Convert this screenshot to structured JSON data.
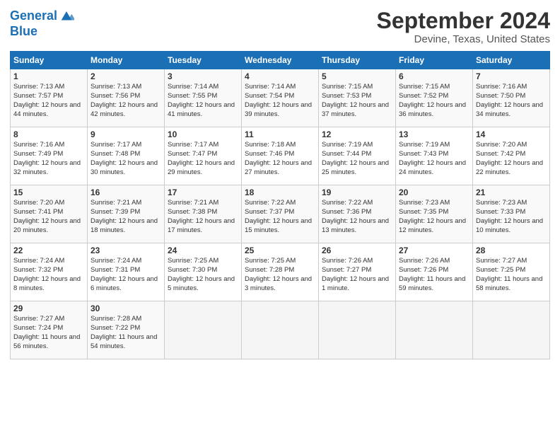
{
  "header": {
    "logo_line1": "General",
    "logo_line2": "Blue",
    "month_title": "September 2024",
    "location": "Devine, Texas, United States"
  },
  "days_of_week": [
    "Sunday",
    "Monday",
    "Tuesday",
    "Wednesday",
    "Thursday",
    "Friday",
    "Saturday"
  ],
  "weeks": [
    [
      {
        "day": "1",
        "sunrise": "7:13 AM",
        "sunset": "7:57 PM",
        "daylight": "12 hours and 44 minutes."
      },
      {
        "day": "2",
        "sunrise": "7:13 AM",
        "sunset": "7:56 PM",
        "daylight": "12 hours and 42 minutes."
      },
      {
        "day": "3",
        "sunrise": "7:14 AM",
        "sunset": "7:55 PM",
        "daylight": "12 hours and 41 minutes."
      },
      {
        "day": "4",
        "sunrise": "7:14 AM",
        "sunset": "7:54 PM",
        "daylight": "12 hours and 39 minutes."
      },
      {
        "day": "5",
        "sunrise": "7:15 AM",
        "sunset": "7:53 PM",
        "daylight": "12 hours and 37 minutes."
      },
      {
        "day": "6",
        "sunrise": "7:15 AM",
        "sunset": "7:52 PM",
        "daylight": "12 hours and 36 minutes."
      },
      {
        "day": "7",
        "sunrise": "7:16 AM",
        "sunset": "7:50 PM",
        "daylight": "12 hours and 34 minutes."
      }
    ],
    [
      {
        "day": "8",
        "sunrise": "7:16 AM",
        "sunset": "7:49 PM",
        "daylight": "12 hours and 32 minutes."
      },
      {
        "day": "9",
        "sunrise": "7:17 AM",
        "sunset": "7:48 PM",
        "daylight": "12 hours and 30 minutes."
      },
      {
        "day": "10",
        "sunrise": "7:17 AM",
        "sunset": "7:47 PM",
        "daylight": "12 hours and 29 minutes."
      },
      {
        "day": "11",
        "sunrise": "7:18 AM",
        "sunset": "7:46 PM",
        "daylight": "12 hours and 27 minutes."
      },
      {
        "day": "12",
        "sunrise": "7:19 AM",
        "sunset": "7:44 PM",
        "daylight": "12 hours and 25 minutes."
      },
      {
        "day": "13",
        "sunrise": "7:19 AM",
        "sunset": "7:43 PM",
        "daylight": "12 hours and 24 minutes."
      },
      {
        "day": "14",
        "sunrise": "7:20 AM",
        "sunset": "7:42 PM",
        "daylight": "12 hours and 22 minutes."
      }
    ],
    [
      {
        "day": "15",
        "sunrise": "7:20 AM",
        "sunset": "7:41 PM",
        "daylight": "12 hours and 20 minutes."
      },
      {
        "day": "16",
        "sunrise": "7:21 AM",
        "sunset": "7:39 PM",
        "daylight": "12 hours and 18 minutes."
      },
      {
        "day": "17",
        "sunrise": "7:21 AM",
        "sunset": "7:38 PM",
        "daylight": "12 hours and 17 minutes."
      },
      {
        "day": "18",
        "sunrise": "7:22 AM",
        "sunset": "7:37 PM",
        "daylight": "12 hours and 15 minutes."
      },
      {
        "day": "19",
        "sunrise": "7:22 AM",
        "sunset": "7:36 PM",
        "daylight": "12 hours and 13 minutes."
      },
      {
        "day": "20",
        "sunrise": "7:23 AM",
        "sunset": "7:35 PM",
        "daylight": "12 hours and 12 minutes."
      },
      {
        "day": "21",
        "sunrise": "7:23 AM",
        "sunset": "7:33 PM",
        "daylight": "12 hours and 10 minutes."
      }
    ],
    [
      {
        "day": "22",
        "sunrise": "7:24 AM",
        "sunset": "7:32 PM",
        "daylight": "12 hours and 8 minutes."
      },
      {
        "day": "23",
        "sunrise": "7:24 AM",
        "sunset": "7:31 PM",
        "daylight": "12 hours and 6 minutes."
      },
      {
        "day": "24",
        "sunrise": "7:25 AM",
        "sunset": "7:30 PM",
        "daylight": "12 hours and 5 minutes."
      },
      {
        "day": "25",
        "sunrise": "7:25 AM",
        "sunset": "7:28 PM",
        "daylight": "12 hours and 3 minutes."
      },
      {
        "day": "26",
        "sunrise": "7:26 AM",
        "sunset": "7:27 PM",
        "daylight": "12 hours and 1 minute."
      },
      {
        "day": "27",
        "sunrise": "7:26 AM",
        "sunset": "7:26 PM",
        "daylight": "11 hours and 59 minutes."
      },
      {
        "day": "28",
        "sunrise": "7:27 AM",
        "sunset": "7:25 PM",
        "daylight": "11 hours and 58 minutes."
      }
    ],
    [
      {
        "day": "29",
        "sunrise": "7:27 AM",
        "sunset": "7:24 PM",
        "daylight": "11 hours and 56 minutes."
      },
      {
        "day": "30",
        "sunrise": "7:28 AM",
        "sunset": "7:22 PM",
        "daylight": "11 hours and 54 minutes."
      },
      {
        "day": "",
        "sunrise": "",
        "sunset": "",
        "daylight": ""
      },
      {
        "day": "",
        "sunrise": "",
        "sunset": "",
        "daylight": ""
      },
      {
        "day": "",
        "sunrise": "",
        "sunset": "",
        "daylight": ""
      },
      {
        "day": "",
        "sunrise": "",
        "sunset": "",
        "daylight": ""
      },
      {
        "day": "",
        "sunrise": "",
        "sunset": "",
        "daylight": ""
      }
    ]
  ]
}
